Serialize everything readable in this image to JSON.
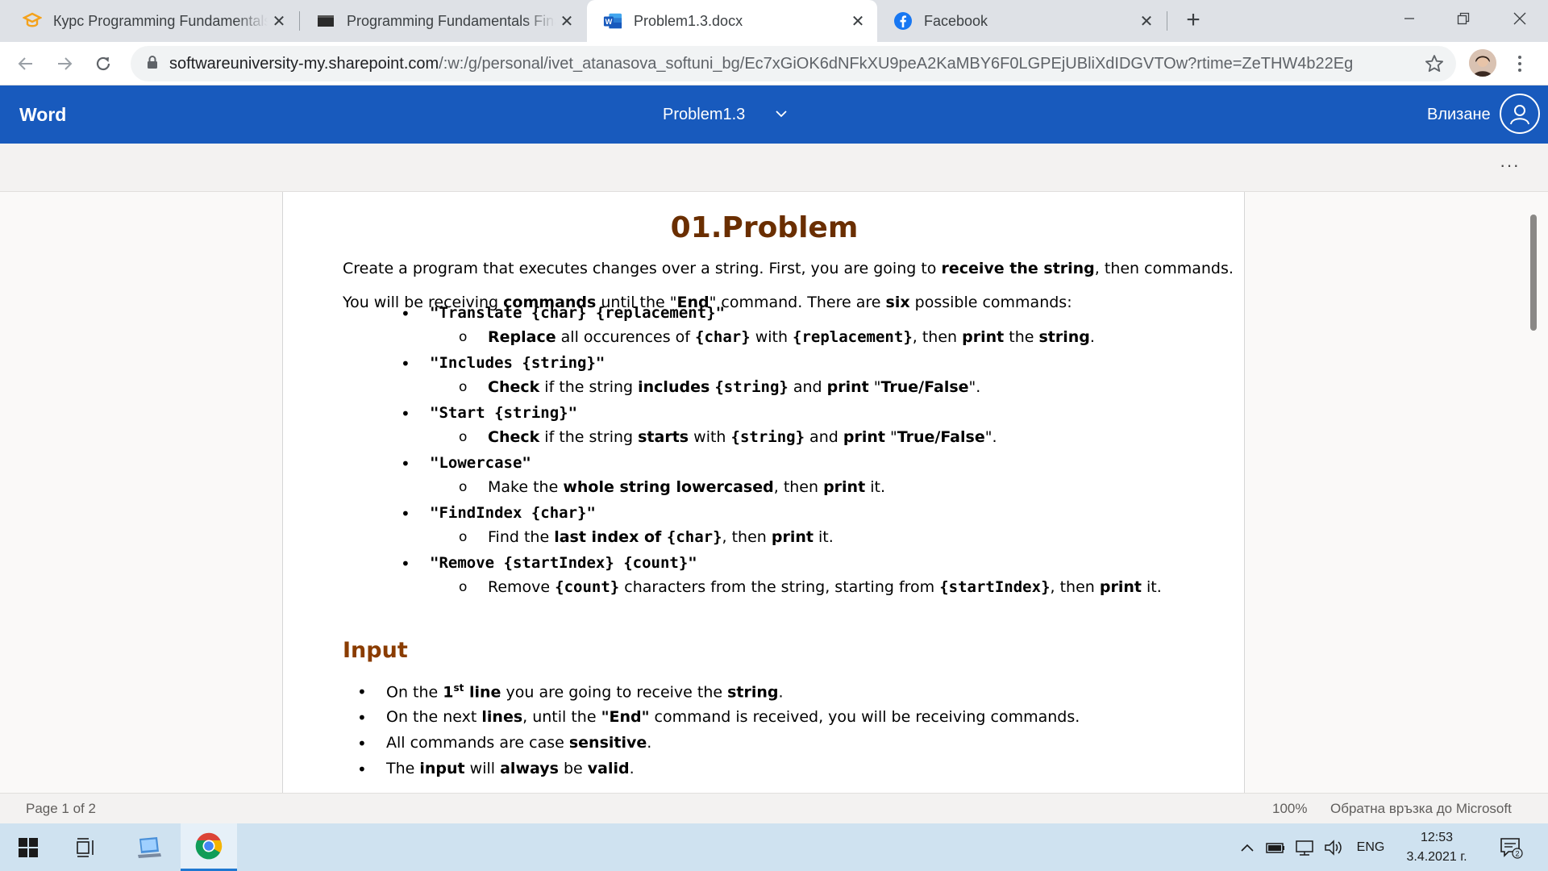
{
  "browser": {
    "tabs": [
      {
        "title": "Курс Programming Fundamentals",
        "icon": "softuni-icon",
        "active": false
      },
      {
        "title": "Programming Fundamentals Final",
        "icon": "video-icon",
        "active": false
      },
      {
        "title": "Problem1.3.docx",
        "icon": "word-icon",
        "active": true
      },
      {
        "title": "Facebook",
        "icon": "facebook-icon",
        "active": false
      }
    ],
    "url_host": "softwareuniversity-my.sharepoint.com",
    "url_path": "/:w:/g/personal/ivet_atanasova_softuni_bg/Ec7xGiOK6dNFkXU9peA2KaMBY6F0LGPEjUBliXdIDGVTOw?rtime=ZeTHW4b22Eg"
  },
  "word": {
    "app_name": "Word",
    "doc_name": "Problem1.3",
    "sign_in": "Влизане",
    "more": "···",
    "brand_color": "#185abd"
  },
  "document": {
    "title": "01.Problem",
    "p1": {
      "a": "Create a program that executes changes over a string. First, you are going to ",
      "b": "receive the string",
      "c": ", then commands."
    },
    "p2": {
      "a": "You will be receiving ",
      "b": "commands",
      "c": " until the \"",
      "d": "End",
      "e": "\" command. There are ",
      "f": "six",
      "g": " possible commands:"
    },
    "commands": [
      {
        "cmd": "\"Translate {char} {replacement}\"",
        "desc": [
          {
            "t": "Replace",
            "s": "b"
          },
          {
            "t": " all occurences of ",
            "s": ""
          },
          {
            "t": "{char}",
            "s": "m"
          },
          {
            "t": " with ",
            "s": ""
          },
          {
            "t": "{replacement}",
            "s": "m"
          },
          {
            "t": ", then ",
            "s": ""
          },
          {
            "t": "print",
            "s": "b"
          },
          {
            "t": " the ",
            "s": ""
          },
          {
            "t": "string",
            "s": "b"
          },
          {
            "t": ".",
            "s": ""
          }
        ]
      },
      {
        "cmd": "\"Includes {string}\"",
        "desc": [
          {
            "t": "Check",
            "s": "b"
          },
          {
            "t": " if the string ",
            "s": ""
          },
          {
            "t": "includes",
            "s": "b"
          },
          {
            "t": " ",
            "s": ""
          },
          {
            "t": "{string}",
            "s": "m"
          },
          {
            "t": " and ",
            "s": ""
          },
          {
            "t": "print",
            "s": "b"
          },
          {
            "t": " \"",
            "s": ""
          },
          {
            "t": "True/False",
            "s": "b"
          },
          {
            "t": "\".",
            "s": ""
          }
        ]
      },
      {
        "cmd": "\"Start {string}\"",
        "desc": [
          {
            "t": "Check",
            "s": "b"
          },
          {
            "t": " if the string ",
            "s": ""
          },
          {
            "t": "starts",
            "s": "b"
          },
          {
            "t": " with ",
            "s": ""
          },
          {
            "t": "{string}",
            "s": "m"
          },
          {
            "t": " and ",
            "s": ""
          },
          {
            "t": "print",
            "s": "b"
          },
          {
            "t": " \"",
            "s": ""
          },
          {
            "t": "True/False",
            "s": "b"
          },
          {
            "t": "\".",
            "s": ""
          }
        ]
      },
      {
        "cmd": "\"Lowercase\"",
        "desc": [
          {
            "t": "Make the ",
            "s": ""
          },
          {
            "t": "whole string lowercased",
            "s": "b"
          },
          {
            "t": ", then ",
            "s": ""
          },
          {
            "t": "print",
            "s": "b"
          },
          {
            "t": " it.",
            "s": ""
          }
        ]
      },
      {
        "cmd": "\"FindIndex {char}\"",
        "desc": [
          {
            "t": "Find the ",
            "s": ""
          },
          {
            "t": "last index of ",
            "s": "b"
          },
          {
            "t": "{char}",
            "s": "m"
          },
          {
            "t": ", then ",
            "s": ""
          },
          {
            "t": "print",
            "s": "b"
          },
          {
            "t": " it.",
            "s": ""
          }
        ]
      },
      {
        "cmd": "\"Remove {startIndex} {count}\"",
        "desc": [
          {
            "t": "Remove ",
            "s": ""
          },
          {
            "t": "{count}",
            "s": "m"
          },
          {
            "t": " characters from the string, starting from ",
            "s": ""
          },
          {
            "t": "{startIndex}",
            "s": "m"
          },
          {
            "t": ", then ",
            "s": ""
          },
          {
            "t": "print",
            "s": "b"
          },
          {
            "t": " it.",
            "s": ""
          }
        ]
      }
    ],
    "input_heading": "Input",
    "input_items": [
      [
        {
          "t": "On the ",
          "s": ""
        },
        {
          "t": "1",
          "s": "b"
        },
        {
          "t": "st",
          "s": "sup"
        },
        {
          "t": " line",
          "s": "b"
        },
        {
          "t": " you are going to receive the ",
          "s": ""
        },
        {
          "t": "string",
          "s": "b"
        },
        {
          "t": ".",
          "s": ""
        }
      ],
      [
        {
          "t": "On the next ",
          "s": ""
        },
        {
          "t": "lines",
          "s": "b"
        },
        {
          "t": ", until the ",
          "s": ""
        },
        {
          "t": "\"End\"",
          "s": "b"
        },
        {
          "t": " command is received, you will be receiving commands.",
          "s": ""
        }
      ],
      [
        {
          "t": "All commands are case ",
          "s": ""
        },
        {
          "t": "sensitive",
          "s": "b"
        },
        {
          "t": ".",
          "s": ""
        }
      ],
      [
        {
          "t": "The ",
          "s": ""
        },
        {
          "t": "input",
          "s": "b"
        },
        {
          "t": " will ",
          "s": ""
        },
        {
          "t": "always",
          "s": "b"
        },
        {
          "t": " be ",
          "s": ""
        },
        {
          "t": "valid",
          "s": "b"
        },
        {
          "t": ".",
          "s": ""
        }
      ]
    ]
  },
  "statusbar": {
    "page": "Page 1 of 2",
    "zoom": "100%",
    "feedback": "Обратна връзка до Microsoft"
  },
  "taskbar": {
    "lang": "ENG",
    "time": "12:53",
    "date": "3.4.2021 г.",
    "notifications": "2"
  }
}
